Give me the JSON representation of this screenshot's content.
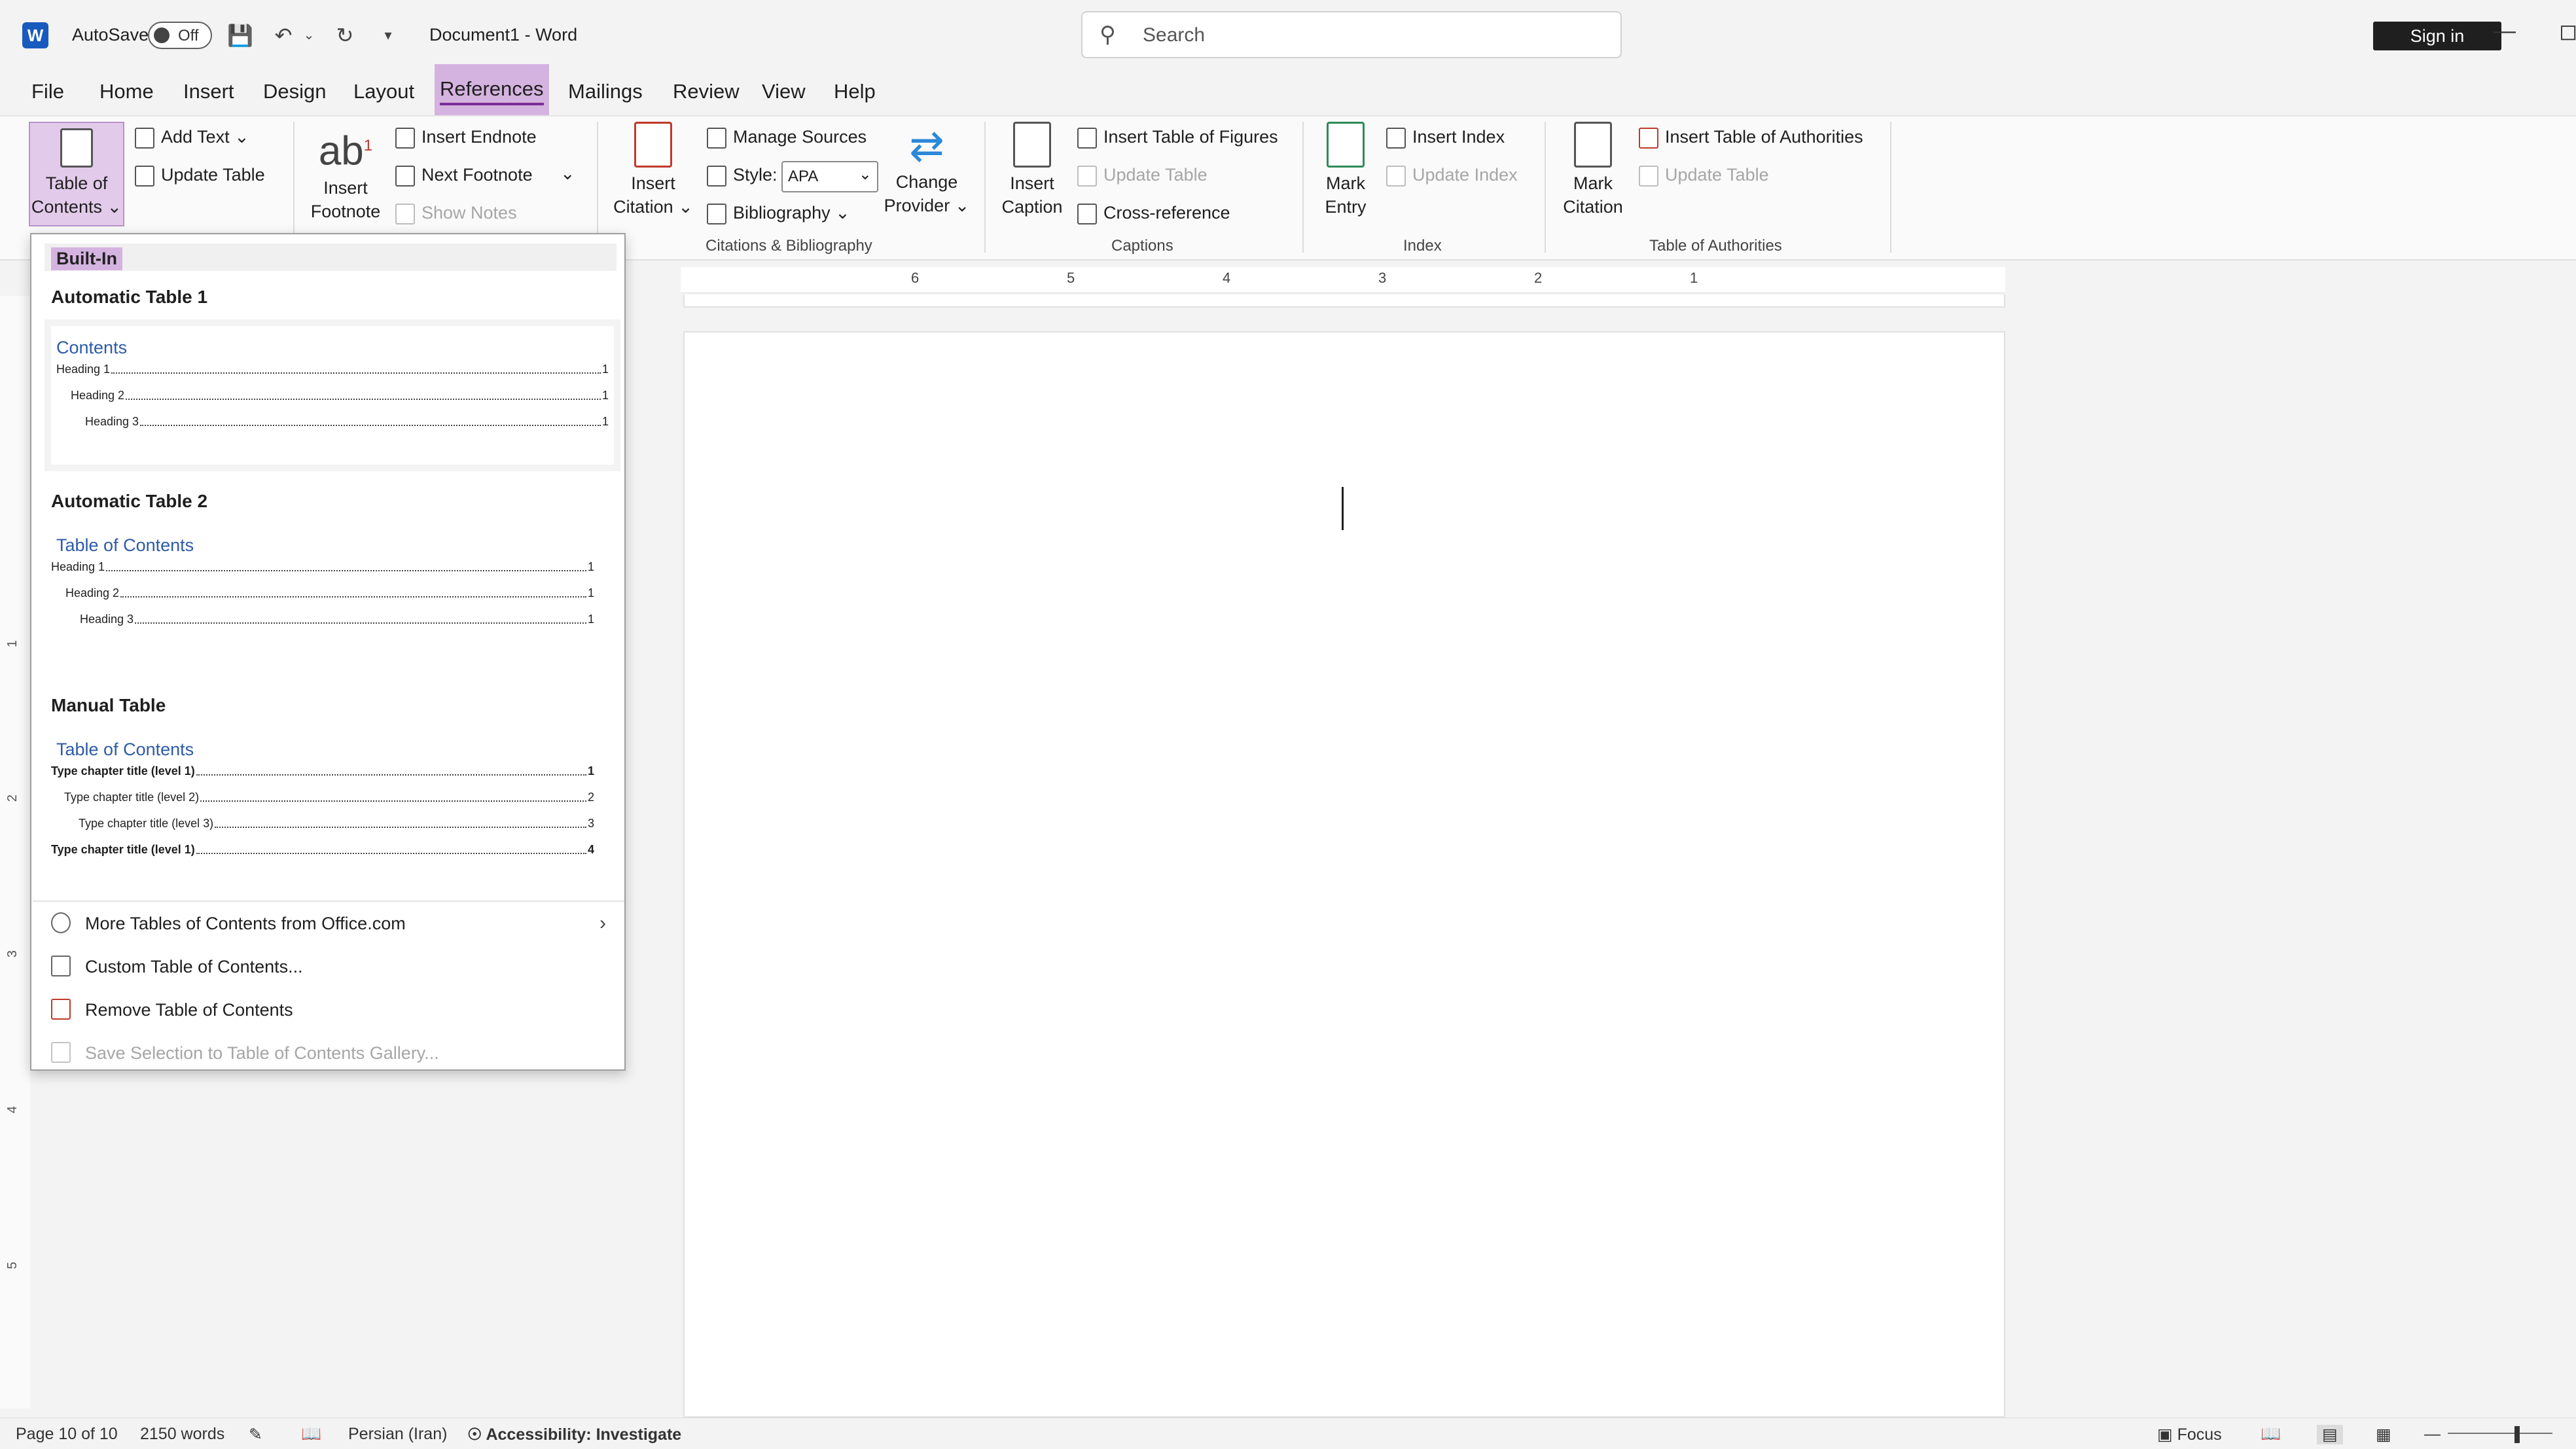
{
  "titlebar": {
    "autosave_label": "AutoSave",
    "autosave_state": "Off",
    "doc_title": "Document1  -  Word",
    "search_placeholder": "Search",
    "signin_label": "Sign in"
  },
  "tabs": [
    "File",
    "Home",
    "Insert",
    "Design",
    "Layout",
    "References",
    "Mailings",
    "Review",
    "View",
    "Help"
  ],
  "active_tab": "References",
  "ribbon": {
    "toc": {
      "line1": "Table of",
      "line2": "Contents"
    },
    "add_text": "Add Text",
    "update_table": "Update Table",
    "insert_footnote": {
      "line1": "Insert",
      "line2": "Footnote",
      "glyph": "ab",
      "sup": "1"
    },
    "insert_endnote": "Insert Endnote",
    "next_footnote": "Next Footnote",
    "show_notes": "Show Notes",
    "insert_citation": {
      "line1": "Insert",
      "line2": "Citation"
    },
    "manage_sources": "Manage Sources",
    "style_label": "Style:",
    "style_value": "APA",
    "bibliography": "Bibliography",
    "change_provider": {
      "line1": "Change",
      "line2": "Provider"
    },
    "citations_group": "Citations & Bibliography",
    "insert_caption": {
      "line1": "Insert",
      "line2": "Caption"
    },
    "insert_table_of_figures": "Insert Table of Figures",
    "update_table_captions": "Update Table",
    "cross_reference": "Cross-reference",
    "captions_group": "Captions",
    "mark_entry": {
      "line1": "Mark",
      "line2": "Entry"
    },
    "insert_index": "Insert Index",
    "update_index": "Update Index",
    "index_group": "Index",
    "mark_citation": {
      "line1": "Mark",
      "line2": "Citation"
    },
    "insert_table_of_authorities": "Insert Table of Authorities",
    "update_table_authorities": "Update Table",
    "authorities_group": "Table of Authorities"
  },
  "ruler": {
    "h_numbers": [
      "6",
      "5",
      "4",
      "3",
      "2",
      "1"
    ],
    "v_numbers": [
      "1",
      "2",
      "3",
      "4",
      "5"
    ]
  },
  "toc_menu": {
    "header": "Built-In",
    "auto1": {
      "title": "Automatic Table 1",
      "heading": "Contents",
      "rows": [
        {
          "label": "Heading 1",
          "page": "1"
        },
        {
          "label": "Heading 2",
          "page": "1"
        },
        {
          "label": "Heading 3",
          "page": "1"
        }
      ]
    },
    "auto2": {
      "title": "Automatic Table 2",
      "heading": "Table of Contents",
      "rows": [
        {
          "label": "Heading 1",
          "page": "1"
        },
        {
          "label": "Heading 2",
          "page": "1"
        },
        {
          "label": "Heading 3",
          "page": "1"
        }
      ]
    },
    "manual": {
      "title": "Manual Table",
      "heading": "Table of Contents",
      "rows": [
        {
          "label": "Type chapter title (level 1)",
          "page": "1"
        },
        {
          "label": "Type chapter title (level 2)",
          "page": "2"
        },
        {
          "label": "Type chapter title (level 3)",
          "page": "3"
        },
        {
          "label": "Type chapter title (level 1)",
          "page": "4"
        }
      ]
    },
    "more": "More Tables of Contents from Office.com",
    "custom": "Custom Table of Contents...",
    "remove": "Remove Table of Contents",
    "save": "Save Selection to Table of Contents Gallery..."
  },
  "statusbar": {
    "page": "Page 10 of 10",
    "words": "2150 words",
    "language": "Persian (Iran)",
    "accessibility": "Accessibility: Investigate",
    "focus": "Focus"
  },
  "colors": {
    "highlight": "#d5b3e0",
    "accent": "#7a2e97",
    "word_blue": "#185abd",
    "toc_heading_blue": "#2e5ba8"
  }
}
